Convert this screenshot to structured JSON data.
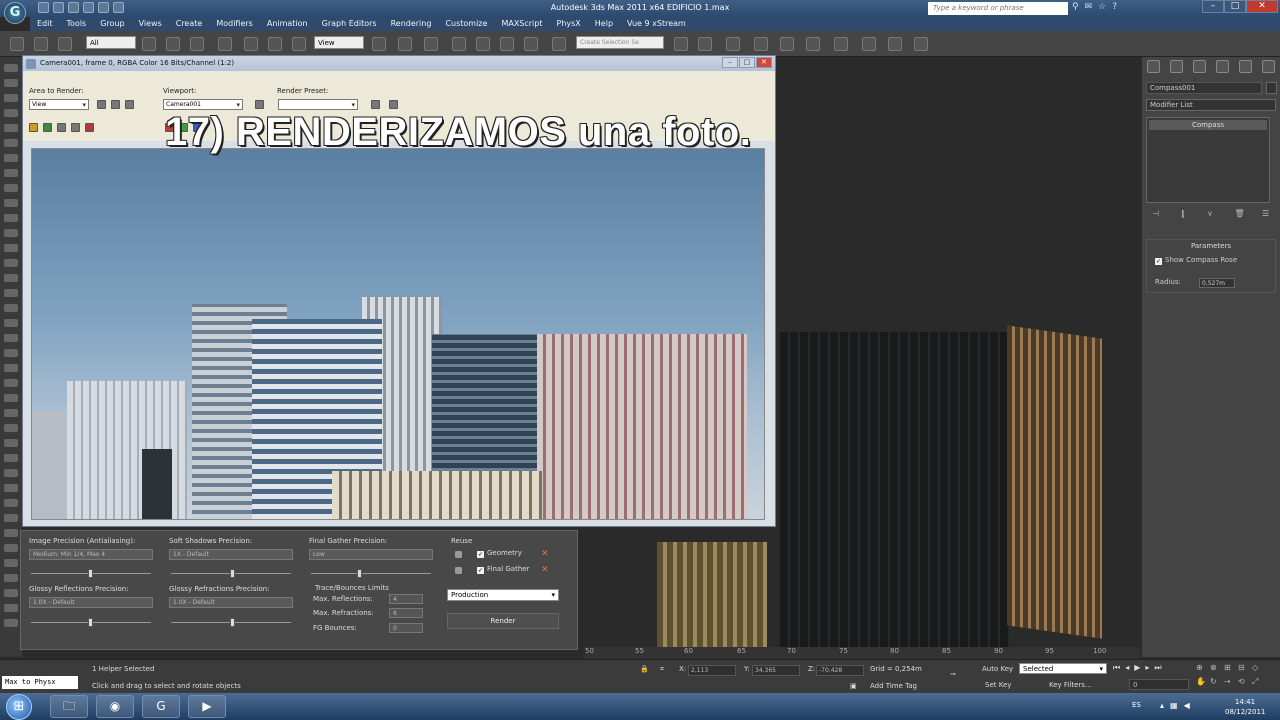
{
  "app": {
    "title": "Autodesk 3ds Max  2011 x64     EDIFICIO 1.max",
    "search_placeholder": "Type a keyword or phrase",
    "logo": "G"
  },
  "menu": [
    "Edit",
    "Tools",
    "Group",
    "Views",
    "Create",
    "Modifiers",
    "Animation",
    "Graph Editors",
    "Rendering",
    "Customize",
    "MAXScript",
    "PhysX",
    "Help",
    "Vue 9 xStream"
  ],
  "toolbar": {
    "selection_filter": "All",
    "ref_coord": "View",
    "named_selection": "Create Selection Se"
  },
  "render_window": {
    "title": "Camera001, frame 0, RGBA Color 16 Bits/Channel (1:2)",
    "area_label": "Area to Render:",
    "area_value": "View",
    "viewport_label": "Viewport:",
    "viewport_value": "Camera001",
    "preset_label": "Render Preset:",
    "preset_value": "",
    "overlay": "17) RENDERIZAMOS una foto."
  },
  "render_settings": {
    "image_precision_label": "Image Precision (Antialiasing):",
    "image_precision_value": "Medium: Min 1/4, Max 4",
    "soft_shadows_label": "Soft Shadows Precision:",
    "soft_shadows_value": "1X - Default",
    "final_gather_label": "Final Gather Precision:",
    "final_gather_value": "Low",
    "reuse_label": "Reuse",
    "geometry_label": "Geometry",
    "final_gather_chk_label": "Final Gather",
    "glossy_reflections_label": "Glossy Reflections Precision:",
    "glossy_reflections_value": "1.0X - Default",
    "glossy_refractions_label": "Glossy Refractions Precision:",
    "glossy_refractions_value": "1.0X - Default",
    "trace_label": "Trace/Bounces Limits",
    "max_reflections_label": "Max. Reflections:",
    "max_reflections_value": "4",
    "max_refractions_label": "Max. Refractions:",
    "max_refractions_value": "6",
    "fg_bounces_label": "FG Bounces:",
    "fg_bounces_value": "0",
    "mode_value": "Production",
    "render_button": "Render"
  },
  "command_panel": {
    "object_name": "Compass001",
    "modifier_list": "Modifier List",
    "stack_item": "Compass",
    "params_title": "Parameters",
    "show_compass": "Show Compass Rose",
    "radius_label": "Radius:",
    "radius_value": "0,527m"
  },
  "ruler": [
    "50",
    "55",
    "60",
    "65",
    "70",
    "75",
    "80",
    "85",
    "90",
    "95",
    "100"
  ],
  "status": {
    "maxscript": "Max to Physx",
    "selected": "1 Helper Selected",
    "prompt": "Click and drag to select and rotate objects",
    "x": "2,113",
    "y": "34,365",
    "z": "-70,428",
    "grid": "Grid = 0,254m",
    "auto_key": "Auto Key",
    "selected_dd": "Selected",
    "set_key": "Set Key",
    "key_filters": "Key Filters...",
    "add_time_tag": "Add Time Tag",
    "frame": "0"
  },
  "taskbar": {
    "lang": "ES",
    "time": "14:41",
    "date": "08/12/2011"
  }
}
